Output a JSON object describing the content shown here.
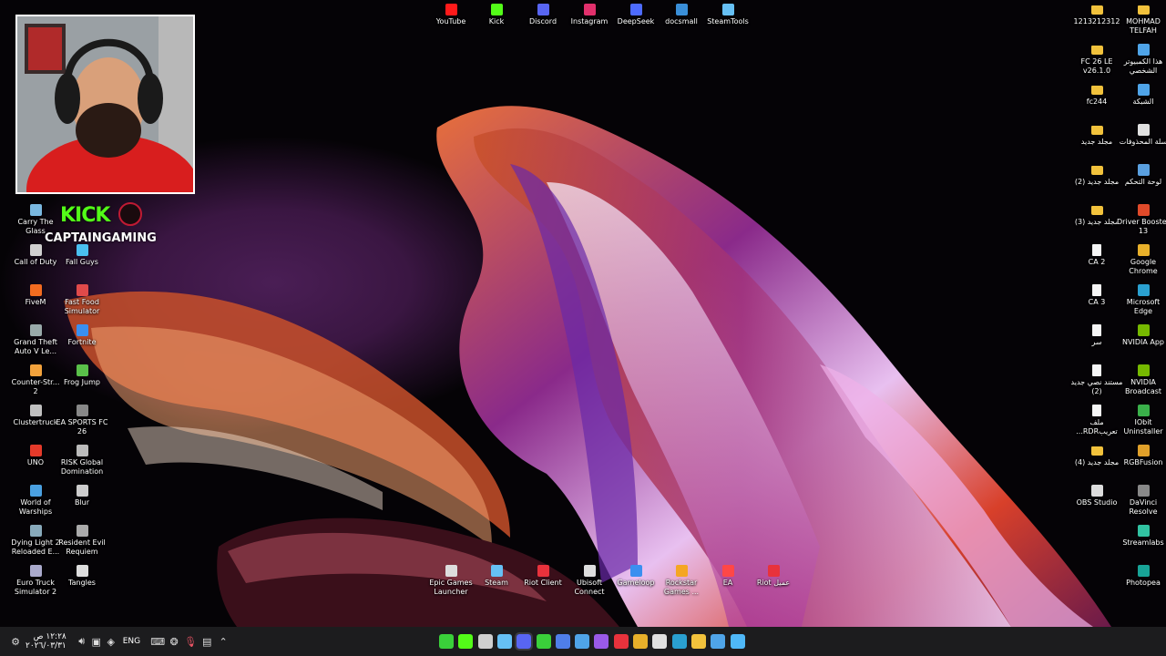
{
  "top_shortcuts": [
    {
      "label": "YouTube",
      "icon": "youtube-icon",
      "color": "#ff1a1a"
    },
    {
      "label": "Kick",
      "icon": "kick-icon",
      "color": "#53fc18"
    },
    {
      "label": "Discord",
      "icon": "discord-icon",
      "color": "#5865f2"
    },
    {
      "label": "Instagram",
      "icon": "instagram-icon",
      "color": "#e1306c"
    },
    {
      "label": "DeepSeek",
      "icon": "deepseek-icon",
      "color": "#4d6bfe"
    },
    {
      "label": "docsmall",
      "icon": "docsmall-icon",
      "color": "#3a8fd8"
    },
    {
      "label": "SteamTools",
      "icon": "steamtools-icon",
      "color": "#66c0f4"
    }
  ],
  "left_col1": [
    {
      "label": "Carry The Glass",
      "icon": "game-icon",
      "color": "#7ab8e0"
    },
    {
      "label": "Call of Duty",
      "icon": "game-icon",
      "color": "#d0d0d0"
    },
    {
      "label": "FiveM",
      "icon": "fivem-icon",
      "color": "#f26b20"
    },
    {
      "label": "Grand Theft Auto V Le...",
      "icon": "gta-icon",
      "color": "#9aa"
    },
    {
      "label": "Counter-Str... 2",
      "icon": "cs2-icon",
      "color": "#f2a23c"
    },
    {
      "label": "Clustertruck",
      "icon": "game-icon",
      "color": "#c0c0c0"
    },
    {
      "label": "UNO",
      "icon": "uno-icon",
      "color": "#e53a2a"
    },
    {
      "label": "World of Warships",
      "icon": "game-icon",
      "color": "#4aa0e0"
    },
    {
      "label": "Dying Light 2 Reloaded E...",
      "icon": "game-icon",
      "color": "#8ab"
    },
    {
      "label": "Euro Truck Simulator 2",
      "icon": "game-icon",
      "color": "#aac"
    }
  ],
  "left_col2": [
    {
      "label": "Fall Guys",
      "icon": "game-icon",
      "color": "#4ac0f0"
    },
    {
      "label": "Fast Food Simulator",
      "icon": "game-icon",
      "color": "#e04a4a"
    },
    {
      "label": "Fortnite",
      "icon": "fortnite-icon",
      "color": "#3a8ff0"
    },
    {
      "label": "Frog Jump",
      "icon": "game-icon",
      "color": "#5ac04a"
    },
    {
      "label": "EA SPORTS FC 26",
      "icon": "game-icon",
      "color": "#888"
    },
    {
      "label": "RISK Global Domination",
      "icon": "game-icon",
      "color": "#bbb"
    },
    {
      "label": "Blur",
      "icon": "game-icon",
      "color": "#ccc"
    },
    {
      "label": "Resident Evil Requiem",
      "icon": "game-icon",
      "color": "#aaa"
    },
    {
      "label": "Tangles",
      "icon": "game-icon",
      "color": "#ddd"
    }
  ],
  "right_col1": [
    {
      "label": "1213212312",
      "type": "folder"
    },
    {
      "label": "FC 26 LE v26.1.0",
      "type": "folder"
    },
    {
      "label": "fc244",
      "type": "folder"
    },
    {
      "label": "مجلد جديد",
      "type": "folder"
    },
    {
      "label": "مجلد جديد (2)",
      "type": "folder"
    },
    {
      "label": "مجلد جديد (3)",
      "type": "folder"
    },
    {
      "label": "CA 2",
      "type": "file"
    },
    {
      "label": "CA 3",
      "type": "file"
    },
    {
      "label": "سر",
      "type": "file"
    },
    {
      "label": "مستند نصي جديد (2)",
      "type": "file"
    },
    {
      "label": "ملف تعريبRDR...",
      "type": "file"
    },
    {
      "label": "مجلد جديد (4)",
      "type": "folder"
    },
    {
      "label": "OBS Studio",
      "type": "app",
      "color": "#ddd"
    }
  ],
  "right_col2": [
    {
      "label": "MOHMAD TELFAH",
      "type": "folder"
    },
    {
      "label": "هذا الكمبيوتر الشخصي",
      "type": "app",
      "color": "#4fa4e8"
    },
    {
      "label": "الشبكة",
      "type": "app",
      "color": "#4fa4e8"
    },
    {
      "label": "سلة المحذوفات",
      "type": "app",
      "color": "#e0e0e0"
    },
    {
      "label": "لوحة التحكم",
      "type": "app",
      "color": "#5aa0e0"
    },
    {
      "label": "Driver Booster 13",
      "type": "app",
      "color": "#e04a2a"
    },
    {
      "label": "Google Chrome",
      "type": "app",
      "color": "#e8b02a"
    },
    {
      "label": "Microsoft Edge",
      "type": "app",
      "color": "#2aa0d0"
    },
    {
      "label": "NVIDIA App",
      "type": "app",
      "color": "#76b900"
    },
    {
      "label": "NVIDIA Broadcast",
      "type": "app",
      "color": "#76b900"
    },
    {
      "label": "IObit Uninstaller",
      "type": "app",
      "color": "#3ab04a"
    },
    {
      "label": "RGBFusion",
      "type": "app",
      "color": "#e0a02a"
    },
    {
      "label": "DaVinci Resolve",
      "type": "app",
      "color": "#888"
    },
    {
      "label": "Streamlabs",
      "type": "app",
      "color": "#31c3a2"
    },
    {
      "label": "Photopea",
      "type": "app",
      "color": "#18a497"
    }
  ],
  "bottom_launchers": [
    {
      "label": "Epic Games Launcher",
      "color": "#ddd"
    },
    {
      "label": "Steam",
      "color": "#66c0f4"
    },
    {
      "label": "Riot Client",
      "color": "#e8323c"
    },
    {
      "label": "Ubisoft Connect",
      "color": "#ddd"
    },
    {
      "label": "Gameloop",
      "color": "#3a8ff0"
    },
    {
      "label": "Rockstar Games ...",
      "color": "#f5a623"
    },
    {
      "label": "EA",
      "color": "#ff4747"
    },
    {
      "label": "عميل Riot",
      "color": "#e8323c"
    }
  ],
  "brand": {
    "platform": "KICK",
    "channel": "CAPTAINGAMING"
  },
  "taskbar": {
    "clock_time": "١٢:٢٨ ص",
    "clock_date": "٢٠٢٦/٠٣/٣١",
    "language": "ENG",
    "pinned": [
      {
        "icon": "play-icon",
        "color": "#3ad03a"
      },
      {
        "icon": "kick-icon",
        "color": "#53fc18"
      },
      {
        "icon": "obs-icon",
        "color": "#cfcfcf"
      },
      {
        "icon": "steam-icon",
        "color": "#66c0f4"
      },
      {
        "icon": "discord-icon",
        "color": "#5865f2"
      },
      {
        "icon": "upwork-icon",
        "color": "#3ad03a"
      },
      {
        "icon": "app-icon",
        "color": "#4f7ee8"
      },
      {
        "icon": "app-icon",
        "color": "#4fa4e8"
      },
      {
        "icon": "app-icon",
        "color": "#9a5ae8"
      },
      {
        "icon": "record-icon",
        "color": "#e8323c"
      },
      {
        "icon": "chrome-icon",
        "color": "#e8b02a"
      },
      {
        "icon": "app-icon",
        "color": "#e0e0e0"
      },
      {
        "icon": "edge-icon",
        "color": "#2aa0d0"
      },
      {
        "icon": "file-explorer-icon",
        "color": "#f2c23c"
      },
      {
        "icon": "store-icon",
        "color": "#4fa4e8"
      },
      {
        "icon": "windows-start-icon",
        "color": "#4fb8f8"
      }
    ]
  }
}
